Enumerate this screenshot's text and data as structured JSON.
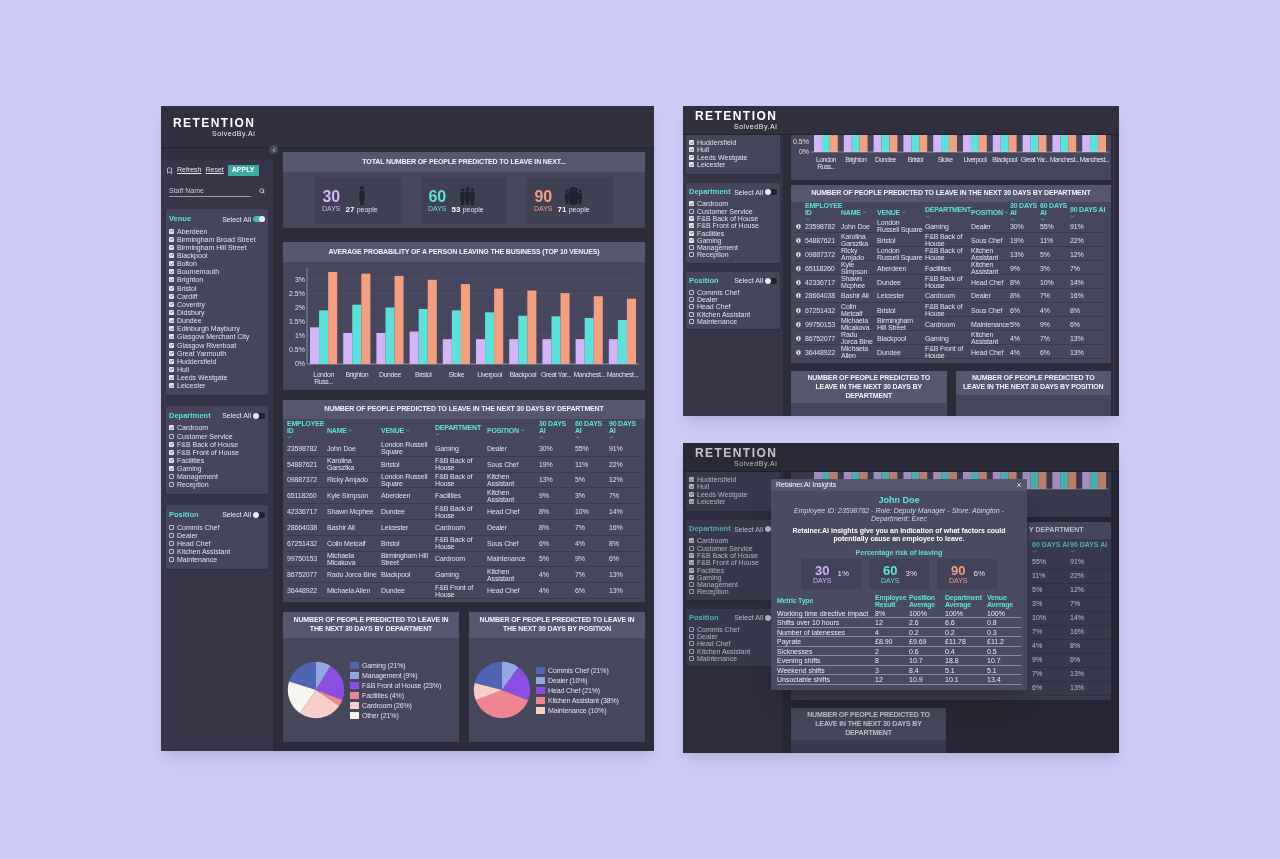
{
  "dashboard": {
    "logo": {
      "title": "RETENTION",
      "subtitle": "SolvedBy.Ai"
    },
    "toolbar": {
      "refresh": "Refresh",
      "reset": "Reset",
      "apply": "APPLY"
    },
    "search": {
      "placeholder": "Staff Name"
    },
    "filters": [
      {
        "title": "Venue",
        "select_all_label": "Select All",
        "select_all": true,
        "items": [
          {
            "label": "Aberdeen",
            "checked": true
          },
          {
            "label": "Birmingham Broad Street",
            "checked": true
          },
          {
            "label": "Birmingham Hill Street",
            "checked": true
          },
          {
            "label": "Blackpool",
            "checked": true
          },
          {
            "label": "Bolton",
            "checked": true
          },
          {
            "label": "Bournemouth",
            "checked": true
          },
          {
            "label": "Brighton",
            "checked": true
          },
          {
            "label": "Bristol",
            "checked": true
          },
          {
            "label": "Cardiff",
            "checked": true
          },
          {
            "label": "Coventry",
            "checked": true
          },
          {
            "label": "Didsbury",
            "checked": true
          },
          {
            "label": "Dundee",
            "checked": true
          },
          {
            "label": "Edinburgh Mayburry",
            "checked": true
          },
          {
            "label": "Glasgow Merchant City",
            "checked": true
          },
          {
            "label": "Glasgow Riverboat",
            "checked": true
          },
          {
            "label": "Great Yarmouth",
            "checked": true
          },
          {
            "label": "Huddersfield",
            "checked": true
          },
          {
            "label": "Hull",
            "checked": true
          },
          {
            "label": "Leeds Westgate",
            "checked": true
          },
          {
            "label": "Leicester",
            "checked": true
          }
        ]
      },
      {
        "title": "Department",
        "select_all_label": "Select All",
        "select_all": false,
        "items": [
          {
            "label": "Cardroom",
            "checked": true
          },
          {
            "label": "Customer Service",
            "checked": false
          },
          {
            "label": "F&B Back of House",
            "checked": true
          },
          {
            "label": "F&B Front of House",
            "checked": true
          },
          {
            "label": "Facilities",
            "checked": true
          },
          {
            "label": "Gaming",
            "checked": true
          },
          {
            "label": "Management",
            "checked": false
          },
          {
            "label": "Reception",
            "checked": false
          }
        ]
      },
      {
        "title": "Position",
        "select_all_label": "Select All",
        "select_all": false,
        "items": [
          {
            "label": "Commis Chef",
            "checked": false
          },
          {
            "label": "Dealer",
            "checked": false
          },
          {
            "label": "Head Chef",
            "checked": false
          },
          {
            "label": "Kitchen Assistant",
            "checked": false
          },
          {
            "label": "Maintenance",
            "checked": false
          }
        ]
      }
    ],
    "totals": {
      "title": "TOTAL NUMBER OF PEOPLE PREDICTED TO LEAVE IN NEXT...",
      "cards": [
        {
          "days": "30",
          "unit": "DAYS",
          "count": "27",
          "count_label": "people",
          "color": "#d3b4f6",
          "kind": "one"
        },
        {
          "days": "60",
          "unit": "DAYS",
          "count": "53",
          "count_label": "people",
          "color": "#5fe0da",
          "kind": "group"
        },
        {
          "days": "90",
          "unit": "DAYS",
          "count": "71",
          "count_label": "people",
          "color": "#f39f82",
          "kind": "crowd"
        }
      ]
    },
    "chart": {
      "title": "AVERAGE PROBABILITY OF A PERSON LEAVING THE BUSINESS (TOP 10 VENUES)",
      "chart_data": {
        "type": "bar",
        "categories": [
          "London Russ...",
          "Brighton",
          "Dundee",
          "Bristol",
          "Stoke",
          "Liverpool",
          "Blackpool",
          "Great Yar...",
          "Manchest...",
          "Manchest..."
        ],
        "series": [
          {
            "color": "#d3b4f6",
            "values": [
              1.3,
              1.1,
              1.1,
              1.15,
              0.88,
              0.88,
              0.88,
              0.88,
              0.88,
              0.88
            ]
          },
          {
            "color": "#5fe0da",
            "values": [
              1.9,
              2.1,
              2.0,
              1.95,
              1.9,
              1.83,
              1.71,
              1.69,
              1.63,
              1.56
            ]
          },
          {
            "color": "#f39f82",
            "values": [
              3.26,
              3.2,
              3.12,
              2.98,
              2.83,
              2.67,
              2.6,
              2.51,
              2.4,
              2.31
            ]
          }
        ],
        "ylim": [
          0,
          3.4
        ],
        "grid": true,
        "yticks": [
          {
            "value": 0,
            "label": "0%"
          },
          {
            "value": 0.5,
            "label": "0.5%"
          },
          {
            "value": 1,
            "label": "1%"
          },
          {
            "value": 1.5,
            "label": "1.5%"
          },
          {
            "value": 2,
            "label": "2%"
          },
          {
            "value": 2.5,
            "label": "2.5%"
          },
          {
            "value": 3,
            "label": "3%"
          }
        ]
      }
    },
    "table": {
      "title": "NUMBER OF PEOPLE PREDICTED TO LEAVE IN THE NEXT 30 DAYS BY DEPARTMENT",
      "columns": [
        {
          "label": "EMPLOYEE ID",
          "sort_ascending": false
        },
        {
          "label": "NAME",
          "sort_ascending": false
        },
        {
          "label": "VENUE",
          "sort_ascending": false
        },
        {
          "label": "DEPARTMENT",
          "sort_ascending": false
        },
        {
          "label": "POSITION",
          "sort_ascending": false
        },
        {
          "label": "30 DAYS AI",
          "sort_ascending": true
        },
        {
          "label": "60 DAYS AI",
          "sort_ascending": false
        },
        {
          "label": "90 DAYS AI",
          "sort_ascending": false
        }
      ],
      "rows": [
        [
          "23598782",
          "John Doe",
          "London Russell Square",
          "Gaming",
          "Dealer",
          "30%",
          "55%",
          "91%"
        ],
        [
          "54887621",
          "Karolina Garsztka",
          "Bristol",
          "F&B Back of House",
          "Sous Chef",
          "19%",
          "11%",
          "22%"
        ],
        [
          "09887372",
          "Ricky Amjado",
          "London Russell Square",
          "F&B Back of House",
          "Kitchen Assistant",
          "13%",
          "5%",
          "12%"
        ],
        [
          "65118260",
          "Kyle Simpson",
          "Aberdeen",
          "Facilities",
          "Kitchen Assistant",
          "9%",
          "3%",
          "7%"
        ],
        [
          "42336717",
          "Shawn Mcphee",
          "Dundee",
          "F&B Back of House",
          "Head Chef",
          "8%",
          "10%",
          "14%"
        ],
        [
          "28664038",
          "Bashir Ali",
          "Leicester",
          "Cardroom",
          "Dealer",
          "8%",
          "7%",
          "16%"
        ],
        [
          "67251432",
          "Colin Metcalf",
          "Bristol",
          "F&B Back of House",
          "Sous Chef",
          "6%",
          "4%",
          "8%"
        ],
        [
          "99750153",
          "Michaela Micakova",
          "Birmingham Hill Street",
          "Cardroom",
          "Maintenance",
          "5%",
          "9%",
          "6%"
        ],
        [
          "86752077",
          "Radu Jorca Bine",
          "Blackpool",
          "Gaming",
          "Kitchen Assistant",
          "4%",
          "7%",
          "13%"
        ],
        [
          "36448922",
          "Michaela Allen",
          "Dundee",
          "F&B Front of House",
          "Head Chef",
          "4%",
          "6%",
          "13%"
        ]
      ]
    },
    "pies": [
      {
        "title": "NUMBER OF PEOPLE PREDICTED TO LEAVE IN THE NEXT 30 DAYS BY DEPARTMENT",
        "chart_data": {
          "type": "pie",
          "categories": [
            "Gaming (21%)",
            "Management (9%)",
            "F&B Front of House (23%)",
            "Facilities (4%)",
            "Cardroom (26%)",
            "Other (21%)"
          ],
          "values": [
            21,
            9,
            23,
            4,
            26,
            21
          ],
          "legend": "right"
        },
        "slices": [
          {
            "color": "#4f65b3"
          },
          {
            "color": "#95a6e6"
          },
          {
            "color": "#8a4fe0"
          },
          {
            "color": "#ef8590"
          },
          {
            "color": "#f6cfc8"
          },
          {
            "color": "#f7f5ef"
          }
        ]
      },
      {
        "title": "NUMBER OF PEOPLE PREDICTED TO LEAVE IN THE NEXT 30 DAYS BY POSITION",
        "chart_data": {
          "type": "pie",
          "categories": [
            "Commis Chef (21%)",
            "Dealer (10%)",
            "Head Chef (21%)",
            "Kitchen Assistant (38%)",
            "Maintenance (10%)"
          ],
          "values": [
            21,
            10,
            21,
            38,
            10
          ],
          "legend": "right"
        },
        "slices": [
          {
            "color": "#4f65b3"
          },
          {
            "color": "#95a6e6"
          },
          {
            "color": "#8a4fe0"
          },
          {
            "color": "#ef8590"
          },
          {
            "color": "#f6cfc8"
          }
        ]
      }
    ]
  },
  "dashboard_scrolled": {
    "logo": {
      "title": "RETENTION",
      "subtitle": "SolvedBy.Ai"
    },
    "filters": [
      {
        "items": [
          {
            "label": "Huddersfield",
            "checked": true
          },
          {
            "label": "Hull",
            "checked": true
          },
          {
            "label": "Leeds Westgate",
            "checked": true
          },
          {
            "label": "Leicester",
            "checked": true
          }
        ]
      },
      {
        "title": "Department",
        "select_all_label": "Select All",
        "select_all": false,
        "items": [
          {
            "label": "Cardroom",
            "checked": true
          },
          {
            "label": "Customer Service",
            "checked": false
          },
          {
            "label": "F&B Back of House",
            "checked": true
          },
          {
            "label": "F&B Front of House",
            "checked": true
          },
          {
            "label": "Facilities",
            "checked": true
          },
          {
            "label": "Gaming",
            "checked": true
          },
          {
            "label": "Management",
            "checked": false
          },
          {
            "label": "Reception",
            "checked": false
          }
        ]
      },
      {
        "title": "Position",
        "select_all_label": "Select All",
        "select_all": false,
        "items": [
          {
            "label": "Commis Chef",
            "checked": false
          },
          {
            "label": "Dealer",
            "checked": false
          },
          {
            "label": "Head Chef",
            "checked": false
          },
          {
            "label": "Kitchen Assistant",
            "checked": false
          },
          {
            "label": "Maintenance",
            "checked": false
          }
        ]
      }
    ],
    "chart_fragment": {
      "ticks": [
        "0.5%",
        "0%"
      ],
      "categories": [
        "London Russ...",
        "Brighton",
        "Dundee",
        "Bristol",
        "Stoke",
        "Liverpool",
        "Blackpool",
        "Great Yar...",
        "Manchest...",
        "Manchest..."
      ]
    },
    "table": {
      "title": "NUMBER OF PEOPLE PREDICTED TO LEAVE IN THE NEXT 30 DAYS BY DEPARTMENT",
      "columns": [
        {
          "label": "EMPLOYEE ID",
          "sort_ascending": false
        },
        {
          "label": "NAME",
          "sort_ascending": false
        },
        {
          "label": "VENUE",
          "sort_ascending": false
        },
        {
          "label": "DEPARTMENT",
          "sort_ascending": false
        },
        {
          "label": "POSITION",
          "sort_ascending": false
        },
        {
          "label": "30 DAYS AI",
          "sort_ascending": true
        },
        {
          "label": "60 DAYS AI",
          "sort_ascending": false
        },
        {
          "label": "90 DAYS AI",
          "sort_ascending": false
        }
      ],
      "rows": [
        [
          "23598782",
          "John Doe",
          "London Russell Square",
          "Gaming",
          "Dealer",
          "30%",
          "55%",
          "91%"
        ],
        [
          "54887621",
          "Karolina Garsztka",
          "Bristol",
          "F&B Back of House",
          "Sous Chef",
          "19%",
          "11%",
          "22%"
        ],
        [
          "09887372",
          "Ricky Amjado",
          "London Russell Square",
          "F&B Back of House",
          "Kitchen Assistant",
          "13%",
          "5%",
          "12%"
        ],
        [
          "65118260",
          "Kyle Simpson",
          "Aberdeen",
          "Facilities",
          "Kitchen Assistant",
          "9%",
          "3%",
          "7%"
        ],
        [
          "42336717",
          "Shawn Mcphee",
          "Dundee",
          "F&B Back of House",
          "Head Chef",
          "8%",
          "10%",
          "14%"
        ],
        [
          "28664038",
          "Bashir Ali",
          "Leicester",
          "Cardroom",
          "Dealer",
          "8%",
          "7%",
          "16%"
        ],
        [
          "67251432",
          "Colin Metcalf",
          "Bristol",
          "F&B Back of House",
          "Sous Chef",
          "6%",
          "4%",
          "8%"
        ],
        [
          "99750153",
          "Michaela Micakova",
          "Birmingham Hill Street",
          "Cardroom",
          "Maintenance",
          "5%",
          "9%",
          "6%"
        ],
        [
          "86752077",
          "Radu Jorca Bine",
          "Blackpool",
          "Gaming",
          "Kitchen Assistant",
          "4%",
          "7%",
          "13%"
        ],
        [
          "36448922",
          "Michaela Allen",
          "Dundee",
          "F&B Front of House",
          "Head Chef",
          "4%",
          "6%",
          "13%"
        ]
      ]
    },
    "pie_titles": [
      "NUMBER OF PEOPLE PREDICTED TO LEAVE IN THE NEXT 30 DAYS BY DEPARTMENT",
      "NUMBER OF PEOPLE PREDICTED TO LEAVE IN THE NEXT 30 DAYS BY POSITION"
    ]
  },
  "insights_view": {
    "logo": {
      "title": "RETENTION",
      "subtitle": "SolvedBy.Ai"
    },
    "filters": [
      {
        "items": [
          {
            "label": "Huddersfield",
            "checked": true
          },
          {
            "label": "Hull",
            "checked": true
          },
          {
            "label": "Leeds Westgate",
            "checked": true
          },
          {
            "label": "Leicester",
            "checked": true
          }
        ]
      },
      {
        "title": "Department",
        "select_all_label": "Select All",
        "select_all": false,
        "items": [
          {
            "label": "Cardroom",
            "checked": true
          },
          {
            "label": "Customer Service",
            "checked": false
          },
          {
            "label": "F&B Back of House",
            "checked": true
          },
          {
            "label": "F&B Front of House",
            "checked": true
          },
          {
            "label": "Facilities",
            "checked": true
          },
          {
            "label": "Gaming",
            "checked": true
          },
          {
            "label": "Management",
            "checked": false
          },
          {
            "label": "Reception",
            "checked": false
          }
        ]
      },
      {
        "title": "Position",
        "select_all_label": "Select All",
        "select_all": false,
        "items": [
          {
            "label": "Commis Chef",
            "checked": false
          },
          {
            "label": "Dealer",
            "checked": false
          },
          {
            "label": "Head Chef",
            "checked": false
          },
          {
            "label": "Kitchen Assistant",
            "checked": false
          },
          {
            "label": "Maintenance",
            "checked": false
          }
        ]
      }
    ],
    "table_fragment": {
      "title": "Y DEPARTMENT",
      "columns": [
        "60 DAYS AI",
        "90 DAYS AI"
      ],
      "rows": [
        [
          "55%",
          "91%"
        ],
        [
          "11%",
          "22%"
        ],
        [
          "5%",
          "12%"
        ],
        [
          "3%",
          "7%"
        ],
        [
          "10%",
          "14%"
        ],
        [
          "7%",
          "16%"
        ],
        [
          "4%",
          "8%"
        ],
        [
          "9%",
          "6%"
        ],
        [
          "7%",
          "13%"
        ],
        [
          "6%",
          "13%"
        ]
      ]
    },
    "pie_title": "NUMBER OF PEOPLE PREDICTED TO LEAVE IN THE NEXT 30 DAYS BY DEPARTMENT",
    "modal": {
      "title": "Retainer.Ai Insights",
      "name": "John Doe",
      "details": "Employee ID: 23598782 - Role: Deputy Manager - Store: Abington - Department: Exec",
      "description": "Retainer.Ai insights give you an indication of what factors could potentially cause an employee to leave.",
      "risk_label": "Percentage risk of leaving",
      "risks": [
        {
          "days": "30",
          "unit": "DAYS",
          "value": "1%",
          "color": "#d3b4f6"
        },
        {
          "days": "60",
          "unit": "DAYS",
          "value": "3%",
          "color": "#5fe0da"
        },
        {
          "days": "90",
          "unit": "DAYS",
          "value": "6%",
          "color": "#f39f82"
        }
      ],
      "columns": [
        "Metric Type",
        "Employee Result",
        "Position Average",
        "Department Average",
        "Venue Average"
      ],
      "rows": [
        [
          "Working time directive impact",
          "8%",
          "100%",
          "100%",
          "100%"
        ],
        [
          "Shifts over 10 hours",
          "12",
          "2.6",
          "6.6",
          "0.8"
        ],
        [
          "Number of latenesses",
          "4",
          "0.2",
          "0.2",
          "0.3"
        ],
        [
          "Payrate",
          "£8.90",
          "£9.69",
          "£11.78",
          "£11.2"
        ],
        [
          "Sicknesses",
          "2",
          "0.6",
          "0.4",
          "0.5"
        ],
        [
          "Evening shifts",
          "8",
          "10.7",
          "18.8",
          "10.7"
        ],
        [
          "Weekend shifts",
          "3",
          "8.4",
          "5.1",
          "5.1"
        ],
        [
          "Unsociable shifts",
          "12",
          "10.9",
          "10.1",
          "13.4"
        ]
      ]
    }
  }
}
